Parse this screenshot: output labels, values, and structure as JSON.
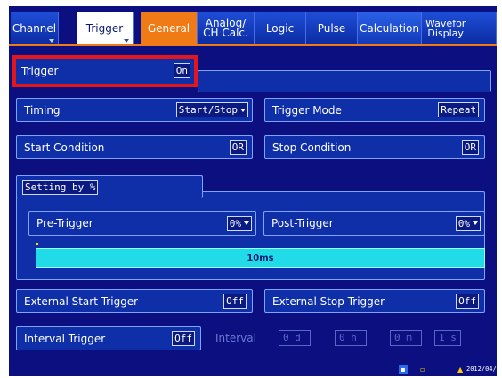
{
  "tabs": [
    {
      "label": "Channel",
      "state": "normal"
    },
    {
      "label": "Trigger",
      "state": "active"
    },
    {
      "label": "General",
      "state": "selected"
    },
    {
      "label": "Analog/\nCH Calc.",
      "state": "normal"
    },
    {
      "label": "Logic",
      "state": "normal"
    },
    {
      "label": "Pulse",
      "state": "normal"
    },
    {
      "label": "Calculation",
      "state": "normal"
    },
    {
      "label": "Wavefor\nDisplay",
      "state": "partial"
    }
  ],
  "trigger": {
    "label": "Trigger",
    "value": "On"
  },
  "timing": {
    "label": "Timing",
    "value": "Start/Stop"
  },
  "trigger_mode": {
    "label": "Trigger Mode",
    "value": "Repeat"
  },
  "start_condition": {
    "label": "Start Condition",
    "value": "OR"
  },
  "stop_condition": {
    "label": "Stop Condition",
    "value": "OR"
  },
  "setting_by": {
    "label": "Setting by %"
  },
  "pre_trigger": {
    "label": "Pre-Trigger",
    "value": "0%"
  },
  "post_trigger": {
    "label": "Post-Trigger",
    "value": "0%"
  },
  "bar": {
    "label": "10ms",
    "fill_fraction": 1.0
  },
  "external_start": {
    "label": "External Start Trigger",
    "value": "Off"
  },
  "external_stop": {
    "label": "External Stop Trigger",
    "value": "Off"
  },
  "interval_trigger": {
    "label": "Interval Trigger",
    "value": "Off"
  },
  "interval": {
    "label": "Interval",
    "values": [
      "0 d",
      "0 h",
      "0 m",
      "1 s"
    ]
  },
  "status": {
    "date": "2012/04/"
  },
  "colors": {
    "background": "#0c0f80",
    "panel": "#0e2fa8",
    "accent": "#f07b16",
    "highlight": "#e4161c",
    "bar": "#22dbe8"
  }
}
